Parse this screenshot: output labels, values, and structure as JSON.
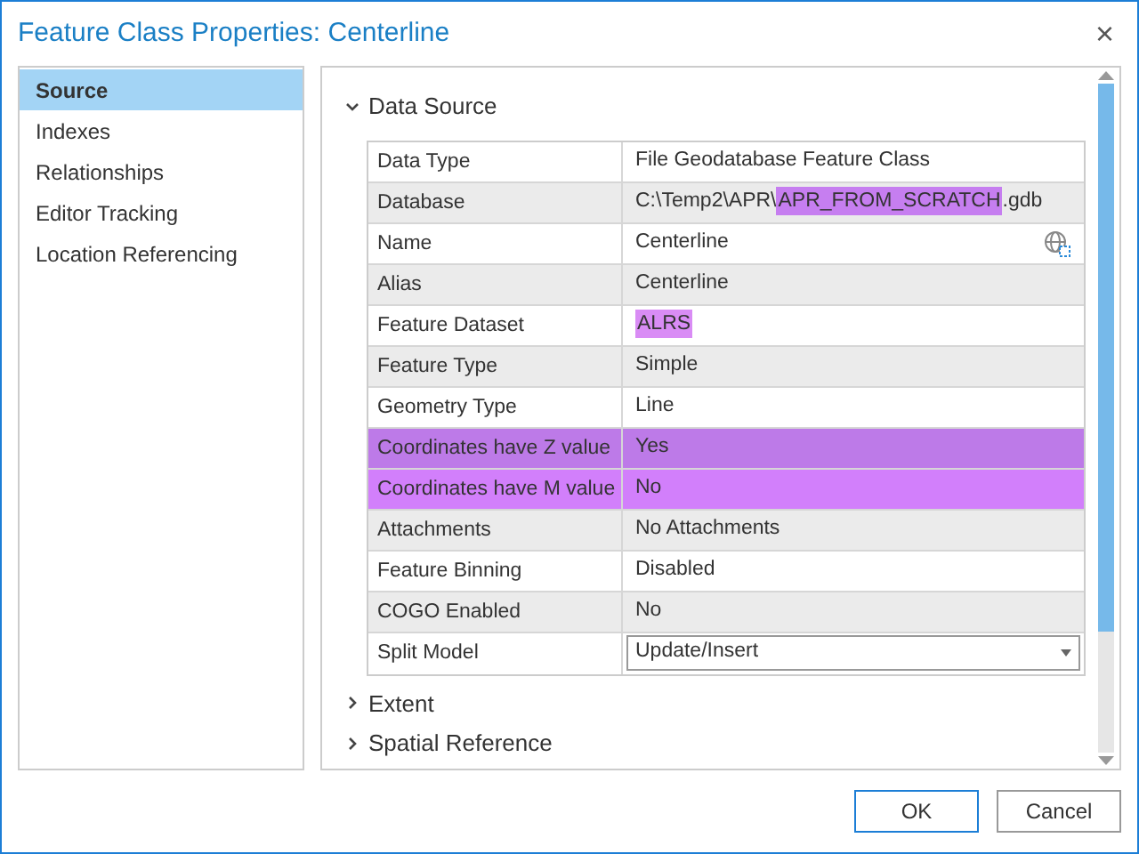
{
  "window": {
    "title": "Feature Class Properties: Centerline",
    "close": "×"
  },
  "sidebar": {
    "items": [
      {
        "label": "Source",
        "selected": true
      },
      {
        "label": "Indexes",
        "selected": false
      },
      {
        "label": "Relationships",
        "selected": false
      },
      {
        "label": "Editor Tracking",
        "selected": false
      },
      {
        "label": "Location Referencing",
        "selected": false
      }
    ]
  },
  "sections": [
    {
      "title": "Data Source",
      "expanded": true,
      "rows": [
        {
          "kind": "text",
          "label": "Data Type",
          "value_parts": [
            {
              "text": "File Geodatabase Feature Class"
            }
          ]
        },
        {
          "kind": "text",
          "label": "Database",
          "value_parts": [
            {
              "text": "C:\\Temp2\\APR\\"
            },
            {
              "text": "APR_FROM_SCRATCH",
              "color": "#c67ef0"
            },
            {
              "text": ".gdb"
            }
          ]
        },
        {
          "kind": "icon",
          "label": "Name",
          "value_parts": [
            {
              "text": "Centerline"
            }
          ]
        },
        {
          "kind": "text",
          "label": "Alias",
          "value_parts": [
            {
              "text": "Centerline"
            }
          ]
        },
        {
          "kind": "text",
          "label": "Feature Dataset",
          "value_parts": [
            {
              "text": "ALRS",
              "color": "#d98cf5"
            }
          ]
        },
        {
          "kind": "text",
          "label": "Feature Type",
          "value_parts": [
            {
              "text": "Simple"
            }
          ]
        },
        {
          "kind": "text",
          "label": "Geometry Type",
          "value_parts": [
            {
              "text": "Line"
            }
          ]
        },
        {
          "kind": "text",
          "label": "Coordinates have Z value",
          "color": "#bd7ae8",
          "value_parts": [
            {
              "text": "Yes"
            }
          ]
        },
        {
          "kind": "text",
          "label": "Coordinates have M value",
          "color": "#d27ffb",
          "value_parts": [
            {
              "text": "No"
            }
          ]
        },
        {
          "kind": "text",
          "label": "Attachments",
          "value_parts": [
            {
              "text": "No Attachments"
            }
          ]
        },
        {
          "kind": "text",
          "label": "Feature Binning",
          "value_parts": [
            {
              "text": "Disabled"
            }
          ]
        },
        {
          "kind": "text",
          "label": "COGO Enabled",
          "value_parts": [
            {
              "text": "No"
            }
          ]
        },
        {
          "kind": "dropdown",
          "label": "Split Model",
          "value_parts": [
            {
              "text": "Update/Insert"
            }
          ]
        }
      ]
    },
    {
      "title": "Extent",
      "expanded": false
    },
    {
      "title": "Spatial Reference",
      "expanded": false
    }
  ],
  "buttons": [
    {
      "label": "OK",
      "default": true
    },
    {
      "label": "Cancel",
      "default": false
    }
  ]
}
